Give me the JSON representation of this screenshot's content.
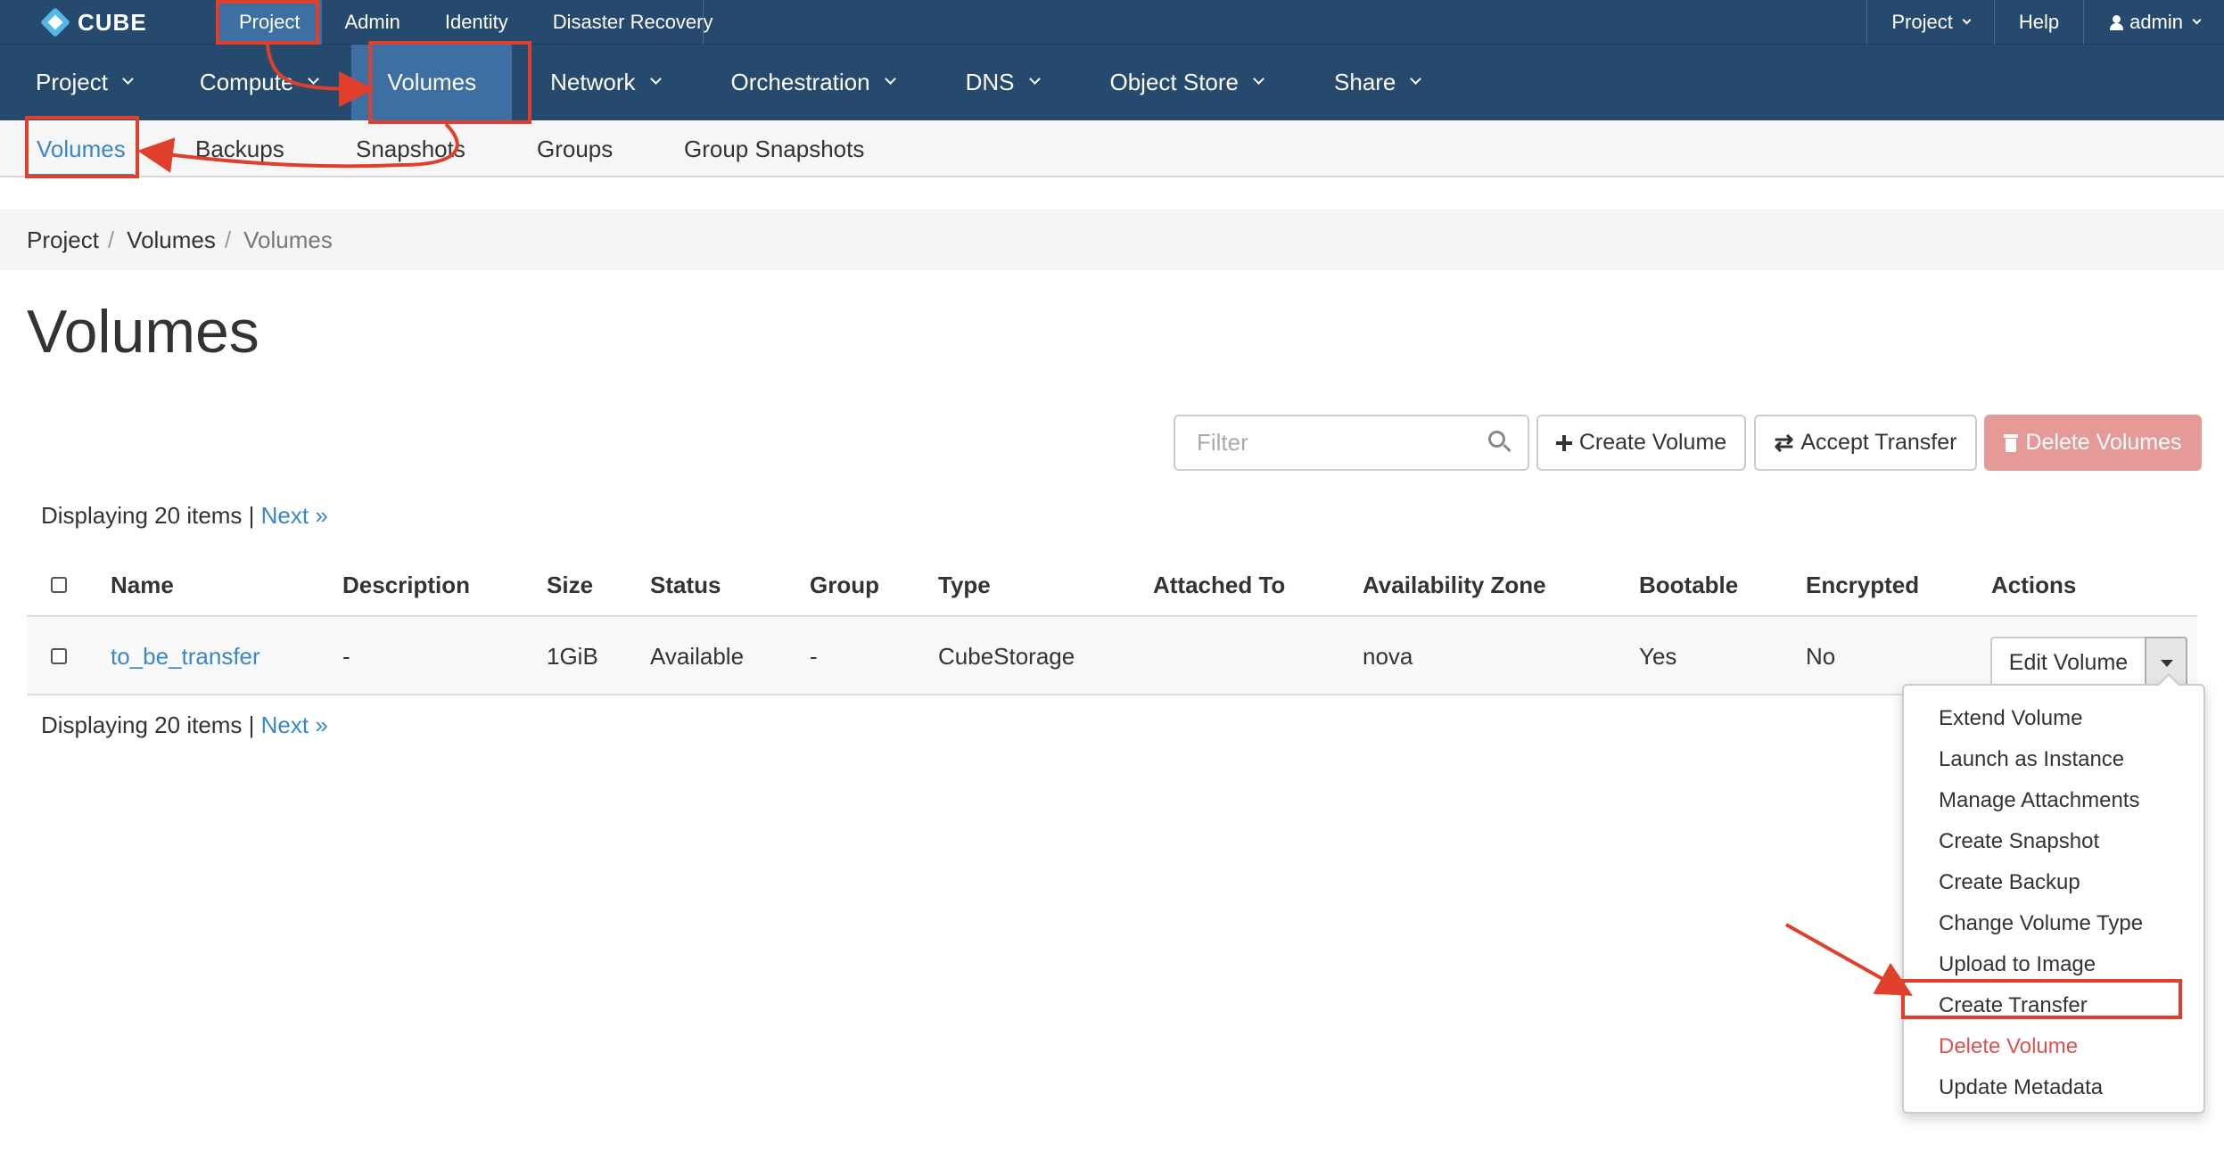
{
  "topbar": {
    "logo_text": "CUBE",
    "nav": [
      "Project",
      "Admin",
      "Identity",
      "Disaster Recovery"
    ],
    "project_menu": "Project",
    "help": "Help",
    "user": "admin"
  },
  "mainnav": [
    "Project",
    "Compute",
    "Volumes",
    "Network",
    "Orchestration",
    "DNS",
    "Object Store",
    "Share"
  ],
  "subnav": [
    "Volumes",
    "Backups",
    "Snapshots",
    "Groups",
    "Group Snapshots"
  ],
  "breadcrumb": [
    "Project",
    "Volumes",
    "Volumes"
  ],
  "page_title": "Volumes",
  "toolbar": {
    "filter_placeholder": "Filter",
    "create_volume": "Create Volume",
    "accept_transfer": "Accept Transfer",
    "delete_volumes": "Delete Volumes"
  },
  "display": {
    "text": "Displaying 20 items | ",
    "next": "Next »"
  },
  "table": {
    "headers": [
      "Name",
      "Description",
      "Size",
      "Status",
      "Group",
      "Type",
      "Attached To",
      "Availability Zone",
      "Bootable",
      "Encrypted",
      "Actions"
    ],
    "rows": [
      {
        "name": "to_be_transfer",
        "description": "-",
        "size": "1GiB",
        "status": "Available",
        "group": "-",
        "type": "CubeStorage",
        "attached_to": "",
        "availability_zone": "nova",
        "bootable": "Yes",
        "encrypted": "No",
        "action": "Edit Volume"
      }
    ]
  },
  "actions_menu": [
    "Extend Volume",
    "Launch as Instance",
    "Manage Attachments",
    "Create Snapshot",
    "Create Backup",
    "Change Volume Type",
    "Upload to Image",
    "Create Transfer",
    "Delete Volume",
    "Update Metadata"
  ],
  "colors": {
    "nav_bg": "#26496e",
    "nav_active": "#3d6fa3",
    "link": "#3a87c8",
    "danger": "#d9534f",
    "annotation": "#e0402b"
  }
}
